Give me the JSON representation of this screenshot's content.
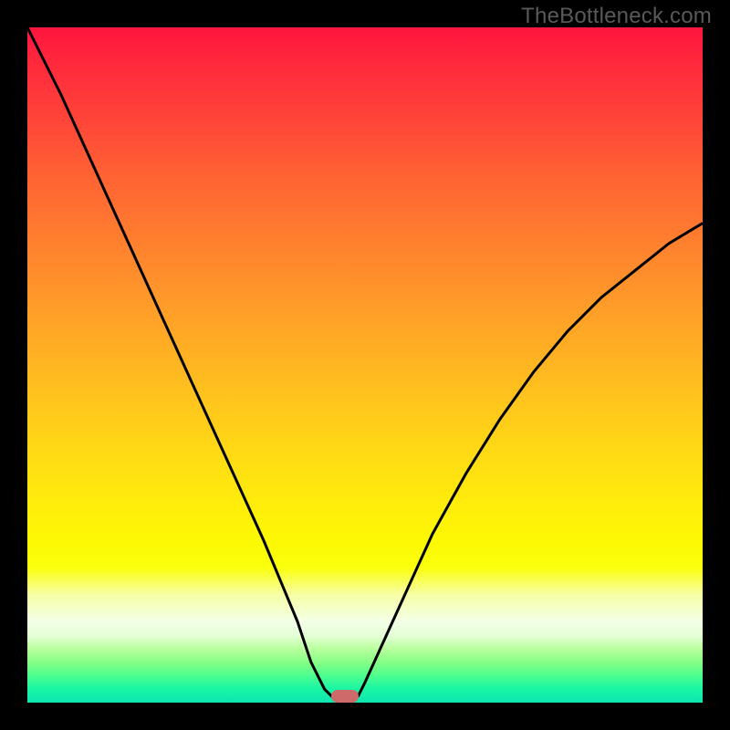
{
  "watermark": "TheBottleneck.com",
  "chart_data": {
    "type": "line",
    "title": "",
    "xlabel": "",
    "ylabel": "",
    "xlim": [
      0,
      100
    ],
    "ylim": [
      0,
      100
    ],
    "grid": false,
    "legend": false,
    "x": [
      0,
      5,
      10,
      15,
      20,
      25,
      30,
      35,
      40,
      42,
      44,
      45,
      46,
      47,
      48,
      49,
      50,
      55,
      60,
      65,
      70,
      75,
      80,
      85,
      90,
      95,
      100
    ],
    "y": [
      100,
      90,
      79,
      68,
      57,
      46,
      35,
      24,
      12,
      6,
      2,
      1,
      0,
      0,
      0,
      1,
      3,
      14,
      25,
      34,
      42,
      49,
      55,
      60,
      64,
      68,
      71
    ],
    "sweet_spot_x_range": [
      45,
      49
    ],
    "annotations": []
  },
  "colors": {
    "frame": "#000000",
    "curve": "#000000",
    "sweet_spot": "#cf6a6a",
    "watermark": "#595959",
    "gradient_top": "#ff153e",
    "gradient_mid": "#ffd716",
    "gradient_bottom": "#0de6af"
  }
}
